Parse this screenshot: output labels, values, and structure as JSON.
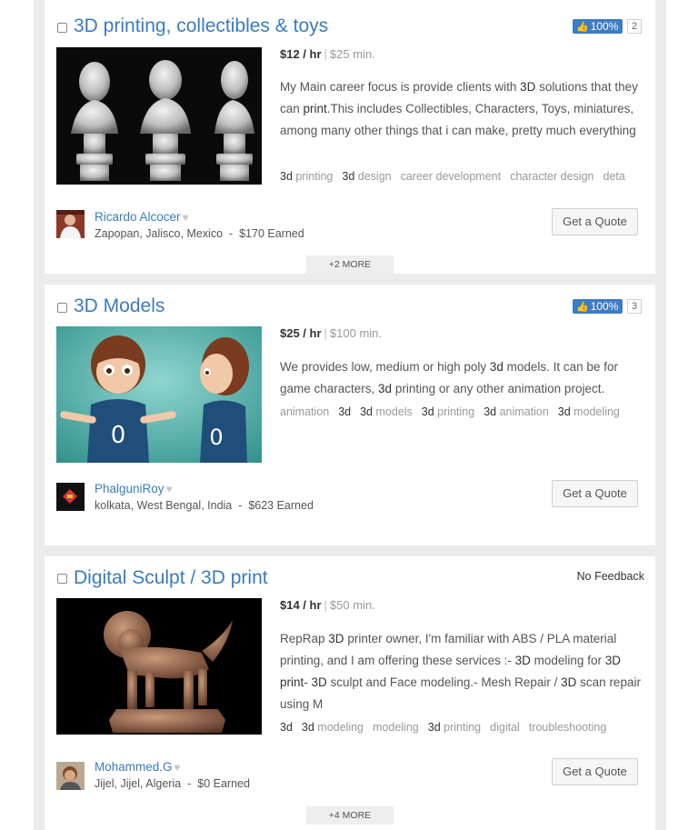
{
  "listings": [
    {
      "title": "3D printing, collectibles & toys",
      "rating": "100%",
      "reviews": "2",
      "rate": "$12 / hr",
      "min": "$25 min.",
      "description": [
        {
          "t": "My Main career focus is provide clients with ",
          "b": false
        },
        {
          "t": "3D",
          "b": true
        },
        {
          "t": " solutions that they can ",
          "b": false
        },
        {
          "t": "print",
          "b": true
        },
        {
          "t": ".This includes Collectibles, Characters, Toys, miniatures, among many other things that i can make, pretty much everything",
          "b": false
        }
      ],
      "tags": [
        [
          {
            "t": "3d",
            "b": true
          },
          {
            "t": " printing",
            "b": false
          }
        ],
        [
          {
            "t": "3d",
            "b": true
          },
          {
            "t": " design",
            "b": false
          }
        ],
        [
          {
            "t": "career development",
            "b": false
          }
        ],
        [
          {
            "t": "character design",
            "b": false
          }
        ],
        [
          {
            "t": "deta",
            "b": false
          }
        ]
      ],
      "user": "Ricardo Alcocer",
      "location": "Zapopan, Jalisco, Mexico",
      "earned": "$170 Earned",
      "quote": "Get a Quote",
      "more": "+2 MORE"
    },
    {
      "title": "3D Models",
      "rating": "100%",
      "reviews": "3",
      "rate": "$25 / hr",
      "min": "$100 min.",
      "description": [
        {
          "t": "We provides low, medium or high poly ",
          "b": false
        },
        {
          "t": "3d",
          "b": true
        },
        {
          "t": " models. It can be for game characters, ",
          "b": false
        },
        {
          "t": "3d",
          "b": true
        },
        {
          "t": " printing or any other animation project.",
          "b": false
        }
      ],
      "tags": [
        [
          {
            "t": "animation",
            "b": false
          }
        ],
        [
          {
            "t": "3d",
            "b": true
          }
        ],
        [
          {
            "t": "3d",
            "b": true
          },
          {
            "t": " models",
            "b": false
          }
        ],
        [
          {
            "t": "3d",
            "b": true
          },
          {
            "t": " printing",
            "b": false
          }
        ],
        [
          {
            "t": "3d",
            "b": true
          },
          {
            "t": " animation",
            "b": false
          }
        ],
        [
          {
            "t": "3d",
            "b": true
          },
          {
            "t": " modeling",
            "b": false
          }
        ]
      ],
      "user": "PhalguniRoy",
      "location": "kolkata, West Bengal, India",
      "earned": "$623 Earned",
      "quote": "Get a Quote"
    },
    {
      "title": "Digital Sculpt / 3D print",
      "feedback": "No Feedback",
      "rate": "$14 / hr",
      "min": "$50 min.",
      "description": [
        {
          "t": "RepRap ",
          "b": false
        },
        {
          "t": "3D",
          "b": true
        },
        {
          "t": " printer owner, I'm familiar with ABS / PLA material printing, and I am offering these services :- ",
          "b": false
        },
        {
          "t": "3D",
          "b": true
        },
        {
          "t": " modeling for ",
          "b": false
        },
        {
          "t": "3D print",
          "b": true
        },
        {
          "t": "- ",
          "b": false
        },
        {
          "t": "3D",
          "b": true
        },
        {
          "t": " sculpt and Face modeling.- Mesh Repair / ",
          "b": false
        },
        {
          "t": "3D",
          "b": true
        },
        {
          "t": " scan repair using M",
          "b": false
        }
      ],
      "tags": [
        [
          {
            "t": "3d",
            "b": true
          }
        ],
        [
          {
            "t": "3d",
            "b": true
          },
          {
            "t": " modeling",
            "b": false
          }
        ],
        [
          {
            "t": "modeling",
            "b": false
          }
        ],
        [
          {
            "t": "3d",
            "b": true
          },
          {
            "t": " printing",
            "b": false
          }
        ],
        [
          {
            "t": "digital",
            "b": false
          }
        ],
        [
          {
            "t": "troubleshooting",
            "b": false
          }
        ]
      ],
      "user": "Mohammed.G",
      "location": "Jijel, Jijel, Algeria",
      "earned": "$0 Earned",
      "quote": "Get a Quote",
      "more": "+4 MORE"
    }
  ],
  "icons": {
    "thumbs_up": "thumbs-up-icon",
    "heart": "heart-icon",
    "checkbox": "checkbox-icon"
  },
  "colors": {
    "link_blue": "#3a7bbf",
    "rating_badge": "#3c7dc3",
    "column_bg": "#ececec"
  }
}
